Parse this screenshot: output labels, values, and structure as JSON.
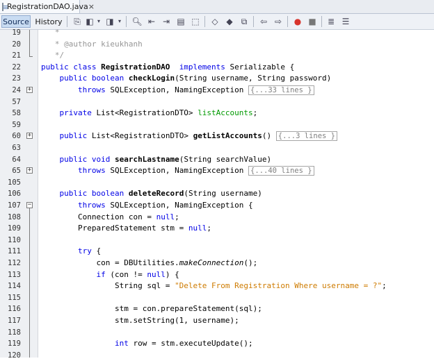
{
  "tab": {
    "title": "RegistrationDAO.java",
    "close": "×"
  },
  "toolbar": {
    "source": "Source",
    "history": "History"
  },
  "editor": {
    "lines": [
      {
        "n": "19",
        "fold": "",
        "segs": [
          [
            "cmt",
            "   *"
          ]
        ]
      },
      {
        "n": "20",
        "fold": "",
        "segs": [
          [
            "cmt",
            "   * @author kieukhanh"
          ]
        ]
      },
      {
        "n": "21",
        "fold": "",
        "segs": [
          [
            "cmt",
            "   */"
          ]
        ]
      },
      {
        "n": "22",
        "fold": "",
        "segs": [
          [
            "kw",
            "public class "
          ],
          [
            "bold",
            "RegistrationDAO"
          ],
          [
            "",
            "  "
          ],
          [
            "kw",
            "implements"
          ],
          [
            "",
            " Serializable {"
          ]
        ]
      },
      {
        "n": "23",
        "fold": "",
        "segs": [
          [
            "",
            "    "
          ],
          [
            "kw",
            "public boolean "
          ],
          [
            "bold",
            "checkLogin"
          ],
          [
            "",
            "(String username, String password)"
          ]
        ]
      },
      {
        "n": "24",
        "fold": "+",
        "segs": [
          [
            "",
            "        "
          ],
          [
            "kw",
            "throws"
          ],
          [
            "",
            " SQLException, NamingException "
          ],
          [
            "folded",
            "{...33 lines }"
          ]
        ]
      },
      {
        "n": "57",
        "fold": "",
        "segs": []
      },
      {
        "n": "58",
        "fold": "",
        "segs": [
          [
            "",
            "    "
          ],
          [
            "kw",
            "private"
          ],
          [
            "",
            " List<RegistrationDTO> "
          ],
          [
            "fld",
            "listAccounts"
          ],
          [
            "",
            ";"
          ]
        ]
      },
      {
        "n": "59",
        "fold": "",
        "segs": []
      },
      {
        "n": "60",
        "fold": "+",
        "segs": [
          [
            "",
            "    "
          ],
          [
            "kw",
            "public"
          ],
          [
            "",
            " List<RegistrationDTO> "
          ],
          [
            "bold",
            "getListAccounts"
          ],
          [
            "",
            "() "
          ],
          [
            "folded",
            "{...3 lines }"
          ]
        ]
      },
      {
        "n": "63",
        "fold": "",
        "segs": []
      },
      {
        "n": "64",
        "fold": "",
        "segs": [
          [
            "",
            "    "
          ],
          [
            "kw",
            "public void "
          ],
          [
            "bold",
            "searchLastname"
          ],
          [
            "",
            "(String searchValue)"
          ]
        ]
      },
      {
        "n": "65",
        "fold": "+",
        "segs": [
          [
            "",
            "        "
          ],
          [
            "kw",
            "throws"
          ],
          [
            "",
            " SQLException, NamingException "
          ],
          [
            "folded",
            "{...40 lines }"
          ]
        ]
      },
      {
        "n": "105",
        "fold": "",
        "segs": []
      },
      {
        "n": "106",
        "fold": "",
        "segs": [
          [
            "",
            "    "
          ],
          [
            "kw",
            "public boolean "
          ],
          [
            "bold",
            "deleteRecord"
          ],
          [
            "",
            "(String username)"
          ]
        ]
      },
      {
        "n": "107",
        "fold": "-",
        "segs": [
          [
            "",
            "        "
          ],
          [
            "kw",
            "throws"
          ],
          [
            "",
            " SQLException, NamingException {"
          ]
        ]
      },
      {
        "n": "108",
        "fold": "",
        "segs": [
          [
            "",
            "        Connection con = "
          ],
          [
            "kw",
            "null"
          ],
          [
            "",
            ";"
          ]
        ]
      },
      {
        "n": "109",
        "fold": "",
        "segs": [
          [
            "",
            "        PreparedStatement stm = "
          ],
          [
            "kw",
            "null"
          ],
          [
            "",
            ";"
          ]
        ]
      },
      {
        "n": "110",
        "fold": "",
        "segs": []
      },
      {
        "n": "111",
        "fold": "",
        "segs": [
          [
            "",
            "        "
          ],
          [
            "kw",
            "try"
          ],
          [
            "",
            " {"
          ]
        ]
      },
      {
        "n": "112",
        "fold": "",
        "segs": [
          [
            "",
            "            con = DBUtilities."
          ],
          [
            "ital",
            "makeConnection"
          ],
          [
            "",
            "();"
          ]
        ]
      },
      {
        "n": "113",
        "fold": "",
        "segs": [
          [
            "",
            "            "
          ],
          [
            "kw",
            "if"
          ],
          [
            "",
            " (con != "
          ],
          [
            "kw",
            "null"
          ],
          [
            "",
            ") {"
          ]
        ]
      },
      {
        "n": "114",
        "fold": "",
        "segs": [
          [
            "",
            "                String sql = "
          ],
          [
            "str",
            "\"Delete From Registration Where username = ?\""
          ],
          [
            "",
            ";"
          ]
        ]
      },
      {
        "n": "115",
        "fold": "",
        "segs": []
      },
      {
        "n": "116",
        "fold": "",
        "segs": [
          [
            "",
            "                stm = con.prepareStatement(sql);"
          ]
        ]
      },
      {
        "n": "117",
        "fold": "",
        "segs": [
          [
            "",
            "                stm.setString(1, username);"
          ]
        ]
      },
      {
        "n": "118",
        "fold": "",
        "segs": []
      },
      {
        "n": "119",
        "fold": "",
        "segs": [
          [
            "",
            "                "
          ],
          [
            "kw",
            "int"
          ],
          [
            "",
            " row = stm.executeUpdate();"
          ]
        ]
      },
      {
        "n": "120",
        "fold": "",
        "segs": []
      }
    ]
  }
}
